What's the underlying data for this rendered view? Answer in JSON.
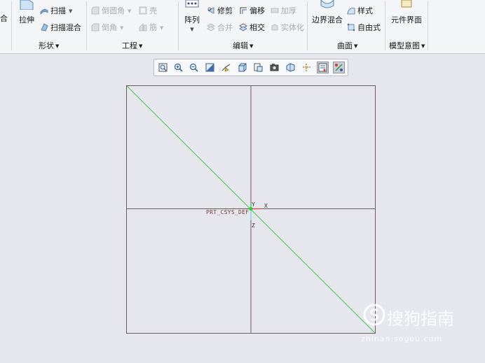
{
  "ribbon": {
    "partial_label": "合",
    "shape": {
      "label": "形状",
      "extrude": "拉伸",
      "sweep": "扫描",
      "swept_blend": "扫描混合"
    },
    "engineering": {
      "label": "工程",
      "round": "倒圆角",
      "chamfer": "倒角",
      "shell": "壳",
      "rib": "筋"
    },
    "editing": {
      "label": "编辑",
      "pattern": "阵列",
      "trim": "修剪",
      "offset": "偏移",
      "thicken": "加厚",
      "merge": "合并",
      "intersect": "相交",
      "solidify": "实体化"
    },
    "surfaces": {
      "label": "曲面",
      "boundary_blend": "边界混合",
      "style": "样式",
      "freestyle": "自由式"
    },
    "model_intent": {
      "label": "模型意图",
      "component_interface": "元件界面"
    }
  },
  "view_toolbar": {
    "buttons": [
      {
        "name": "refit-icon",
        "active": false
      },
      {
        "name": "zoom-in-icon",
        "active": false
      },
      {
        "name": "zoom-out-icon",
        "active": false
      },
      {
        "name": "repaint-icon",
        "active": false
      },
      {
        "name": "reorient-icon",
        "active": false
      },
      {
        "name": "display-style-icon",
        "active": false
      },
      {
        "name": "saved-orientations-icon",
        "active": false
      },
      {
        "name": "view-manager-icon",
        "active": false
      },
      {
        "name": "perspective-icon",
        "active": false
      },
      {
        "name": "datum-display-icon",
        "active": false
      },
      {
        "name": "annotation-display-icon",
        "active": true
      },
      {
        "name": "spin-center-icon",
        "active": true
      }
    ]
  },
  "canvas": {
    "csys_label": "PRT_CSYS_DEF",
    "axis_x": "X",
    "axis_y": "Y",
    "axis_z": "Z",
    "datum_color": "#6e5a5a",
    "line_color": "#40c84a"
  },
  "watermark": {
    "brand": "搜狗指南",
    "url": "zhinan.sogou.com"
  }
}
